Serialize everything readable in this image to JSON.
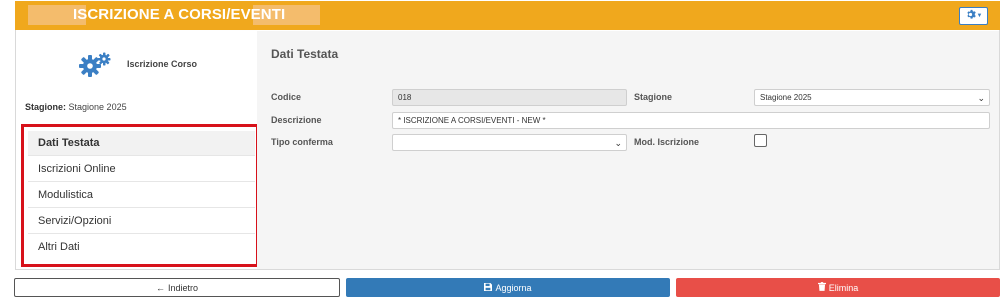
{
  "header": {
    "title": "ISCRIZIONE A CORSI/EVENTI",
    "accent_color": "#f0a81d",
    "settings_icon": "gear-icon"
  },
  "sidebar": {
    "title": "Iscrizione Corso",
    "title_icon": "gears-icon",
    "season_label": "Stagione:",
    "season_value": "Stagione 2025",
    "nav": [
      {
        "label": "Dati Testata",
        "active": true
      },
      {
        "label": "Iscrizioni Online"
      },
      {
        "label": "Modulistica"
      },
      {
        "label": "Servizi/Opzioni"
      },
      {
        "label": "Altri Dati"
      }
    ]
  },
  "form": {
    "section_title": "Dati Testata",
    "codice_label": "Codice",
    "codice_value": "018",
    "stagione_label": "Stagione",
    "stagione_value": "Stagione 2025",
    "descrizione_label": "Descrizione",
    "descrizione_value": "* ISCRIZIONE A CORSI/EVENTI - NEW *",
    "tipo_conferma_label": "Tipo conferma",
    "tipo_conferma_value": "",
    "mod_iscrizione_label": "Mod. Iscrizione",
    "mod_iscrizione_checked": false
  },
  "footer": {
    "back_label": "Indietro",
    "save_label": "Aggiorna",
    "delete_label": "Elimina",
    "save_color": "#337ab7",
    "delete_color": "#e84f48"
  }
}
